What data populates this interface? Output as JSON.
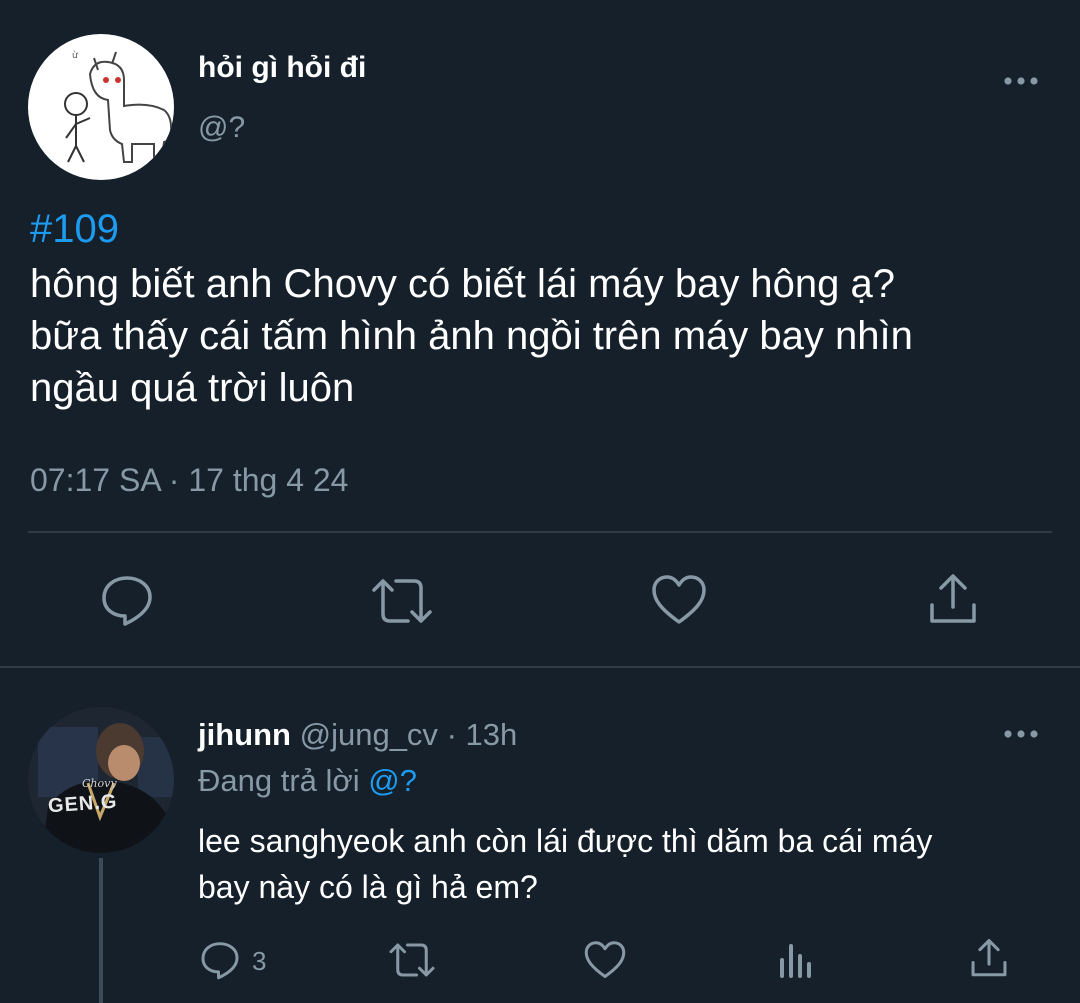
{
  "tweet": {
    "author_name": "hỏi gì hỏi đi",
    "author_handle": "@?",
    "hashtag": "#109",
    "body_lines": [
      "hông biết anh Chovy có biết lái máy bay hông ạ?",
      "bữa thấy cái tấm hình ảnh ngồi trên máy bay nhìn",
      "ngầu quá trời luôn"
    ],
    "timestamp": "07:17 SA · 17 thg 4 24"
  },
  "reply": {
    "author_name": "jihunn",
    "author_handle": "@jung_cv",
    "time": "· 13h",
    "replying_prefix": "Đang trả lời",
    "replying_to": "@?",
    "body_lines": [
      "lee sanghyeok anh còn lái được thì dăm ba cái máy",
      "bay này có là gì hả em?"
    ],
    "reply_count": "3",
    "avatar_jersey_name": "Chovy",
    "avatar_team": "GEN.G"
  },
  "icons": {
    "more": "more-icon",
    "reply": "reply-icon",
    "retweet": "retweet-icon",
    "like": "like-icon",
    "share": "share-icon",
    "analytics": "analytics-icon"
  },
  "colors": {
    "background": "#15202b",
    "text": "#ffffff",
    "muted": "#8899a6",
    "accent": "#1d9bf0",
    "divider": "#2f3b47"
  }
}
